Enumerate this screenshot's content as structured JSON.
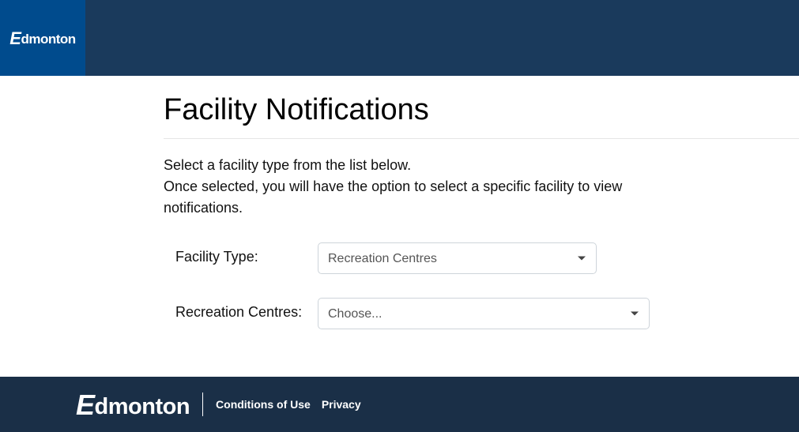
{
  "header": {
    "logo_text": "Edmonton"
  },
  "main": {
    "title": "Facility Notifications",
    "instructions_line1": "Select a facility type from the list below.",
    "instructions_line2": "Once selected, you will have the option to select a specific facility to view notifications.",
    "facility_type": {
      "label": "Facility Type:",
      "selected": "Recreation Centres"
    },
    "recreation_centres": {
      "label": "Recreation Centres:",
      "selected": "Choose..."
    }
  },
  "footer": {
    "logo_text": "Edmonton",
    "links": {
      "conditions": "Conditions of Use",
      "privacy": "Privacy"
    }
  }
}
